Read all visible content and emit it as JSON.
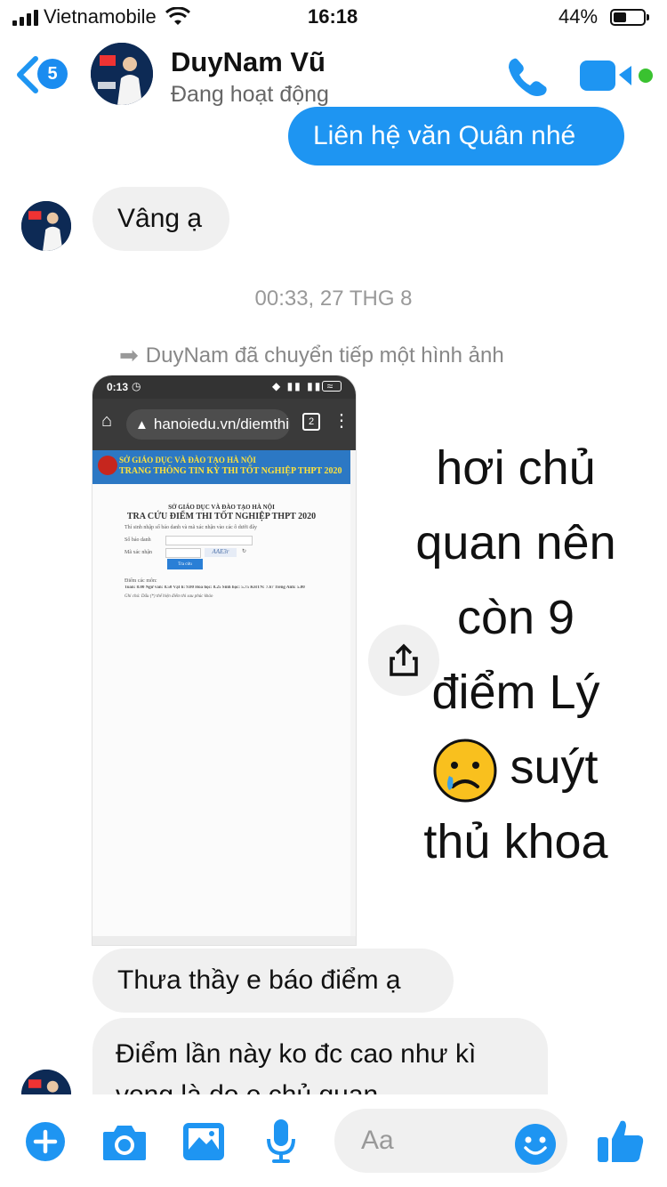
{
  "status_bar": {
    "carrier": "Vietnamobile",
    "time": "16:18",
    "battery": "44%",
    "battery_level": 0.44
  },
  "header": {
    "back_count": "5",
    "contact_name": "DuyNam Vũ",
    "contact_status": "Đang hoạt động",
    "accent_color": "#1e95f2"
  },
  "messages": {
    "outgoing_1": "Liên hệ văn Quân nhé",
    "incoming_1": "Vâng ạ",
    "timestamp": "00:33, 27 THG 8",
    "forward_notice": "DuyNam đã chuyển tiếp một hình ảnh",
    "incoming_2": "Thưa thầy e báo điểm ạ",
    "incoming_3_line1": "Điểm lần này ko đc cao như kì",
    "incoming_3_line2": "vong là do e chủ quan"
  },
  "forwarded_image": {
    "phone_time": "0:13",
    "url": "hanoiedu.vn/diemthi",
    "tab_count": "2",
    "banner_line1": "SỞ GIÁO DỤC VÀ ĐÀO TẠO HÀ NỘI",
    "banner_line2": "TRANG THÔNG TIN KỲ THI TỐT NGHIỆP THPT 2020",
    "page_heading_small": "SỞ GIÁO DỤC VÀ ĐÀO TẠO HÀ NỘI",
    "page_heading": "TRA CỨU ĐIỂM THI TỐT NGHIỆP THPT 2020",
    "instructions": "Thí sinh nhập số báo danh và mã xác nhận vào các ô dưới đây",
    "label_sbd": "Số báo danh",
    "label_captcha": "Mã xác nhận",
    "captcha_value": "AAE3r",
    "search_button": "Tra cứu",
    "scores_label": "Điểm các môn:",
    "scores_line": "Toán: 8.00 Ngữ văn: 8.50 Vật lí: 9.00 Hóa học: 8.25 Sinh học: 5.75 KHTN: 7.67 Tiếng Anh: 5.00",
    "note": "Ghi chú: Dấu (*) thể hiện điểm thi sau phúc khảo"
  },
  "overlay_caption": {
    "line1": "hơi chủ",
    "line2": "quan nên",
    "line3": "còn 9",
    "line4": "điểm Lý",
    "line5": "suýt",
    "line6": "thủ khoa"
  },
  "composer": {
    "placeholder": "Aa"
  }
}
